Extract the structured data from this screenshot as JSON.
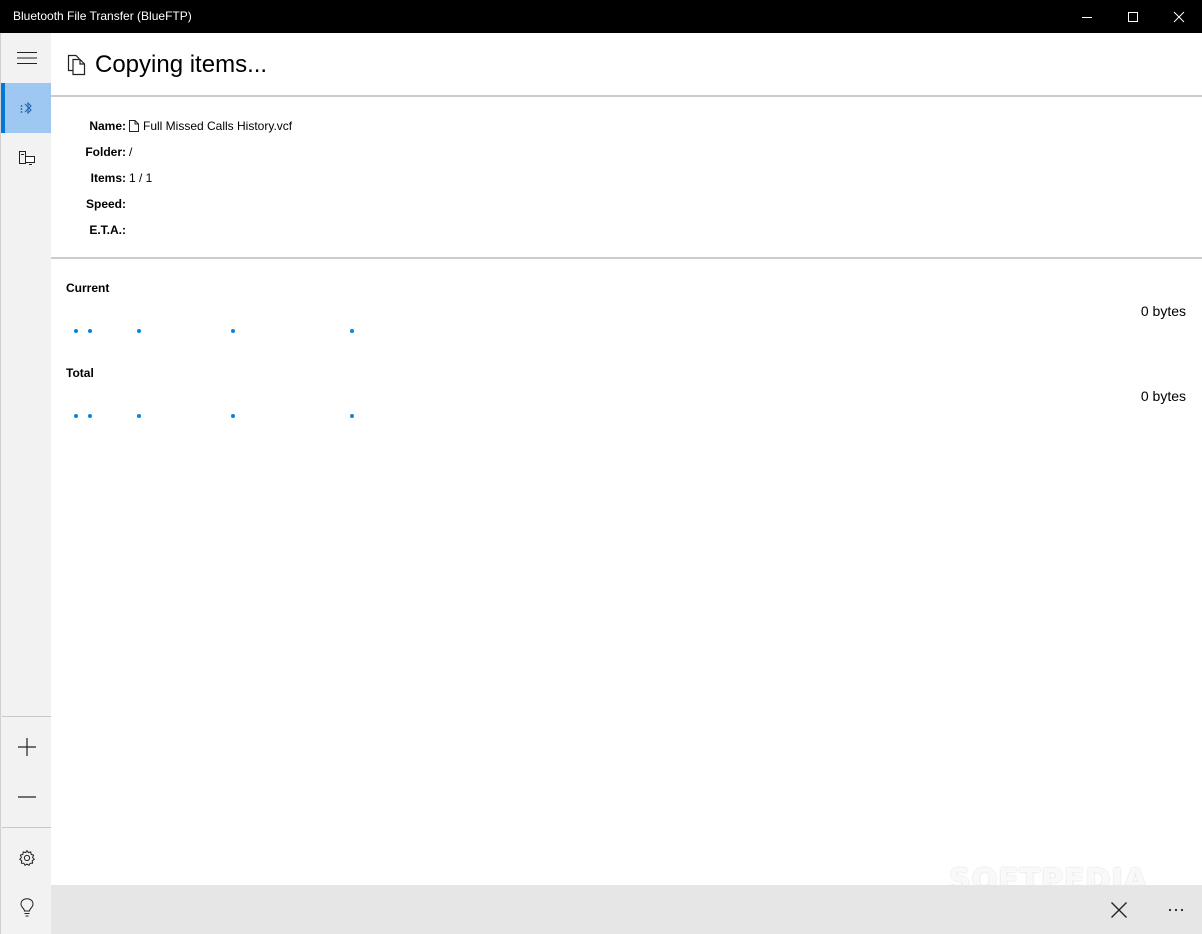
{
  "window": {
    "title": "Bluetooth File Transfer (BlueFTP)"
  },
  "header": {
    "title": "Copying items..."
  },
  "info": {
    "name_label": "Name:",
    "name_value": "Full Missed Calls History.vcf",
    "folder_label": "Folder:",
    "folder_value": "/",
    "items_label": "Items:",
    "items_value": "1 / 1",
    "speed_label": "Speed:",
    "speed_value": "",
    "eta_label": "E.T.A.:",
    "eta_value": ""
  },
  "progress": {
    "current_label": "Current",
    "current_bytes": "0 bytes",
    "total_label": "Total",
    "total_bytes": "0 bytes",
    "accent_color": "#0a84d9"
  },
  "watermark": "SOFTPEDIA",
  "icons": {
    "sidebar": [
      "hamburger-icon",
      "bluetooth-icon",
      "devices-icon",
      "add-icon",
      "remove-icon",
      "settings-icon",
      "lightbulb-icon"
    ],
    "header": "copy-icon",
    "cmdbar": [
      "close-icon",
      "more-icon"
    ]
  }
}
